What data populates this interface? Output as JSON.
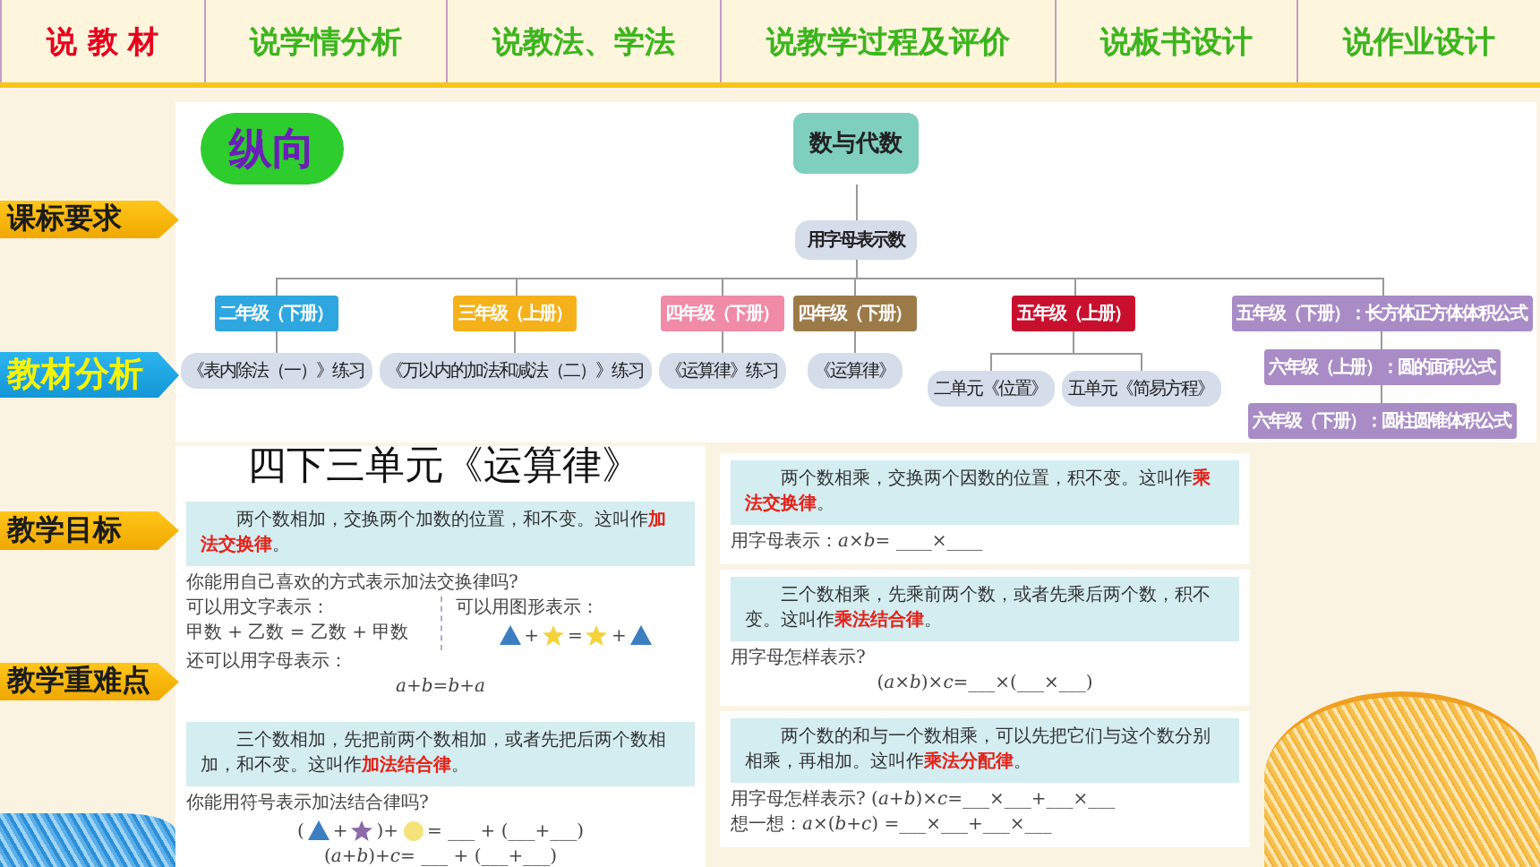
{
  "nav": [
    {
      "label": "说 教 材",
      "selected": true
    },
    {
      "label": "说学情分析",
      "selected": false
    },
    {
      "label": "说教法、学法",
      "selected": false
    },
    {
      "label": "说教学过程及评价",
      "selected": false
    },
    {
      "label": "说板书设计",
      "selected": false
    },
    {
      "label": "说作业设计",
      "selected": false
    }
  ],
  "sidebar": [
    {
      "label": "课标要求",
      "selected": false
    },
    {
      "label": "教材分析",
      "selected": true
    },
    {
      "label": "教学目标",
      "selected": false
    },
    {
      "label": "教学重难点",
      "selected": false
    }
  ],
  "diagram": {
    "tag": "纵向",
    "root": "数与代数",
    "branch": "用字母表示数",
    "grades": [
      {
        "label": "二年级（下册）",
        "color": "#2ea7e0",
        "kind": "pills",
        "children": [
          {
            "label": "《表内除法（一）》练习"
          }
        ]
      },
      {
        "label": "三年级（上册）",
        "color": "#f5b11a",
        "kind": "pills",
        "children": [
          {
            "label": "《万以内的加法和减法（二）》练习"
          }
        ]
      },
      {
        "label": "四年级（下册）",
        "color": "#f08aa6",
        "kind": "pills",
        "children": [
          {
            "label": "《运算律》练习"
          }
        ]
      },
      {
        "label": "四年级（下册）",
        "color": "#9c7a48",
        "kind": "pills",
        "children": [
          {
            "label": "《运算律》"
          }
        ]
      },
      {
        "label": "五年级（上册）",
        "color": "#c8102e",
        "kind": "pills",
        "children": [
          {
            "label": "二单元《位置》"
          },
          {
            "label": "五单元《简易方程》"
          }
        ]
      },
      {
        "label": "五年级（下册）：长方体正方体体积公式",
        "color": "#a98cc6",
        "kind": "chain",
        "children": [
          {
            "label": "六年级（上册）：圆的面积公式",
            "children": [
              {
                "label": "六年级（下册）：圆柱圆锥体积公式"
              }
            ]
          }
        ]
      }
    ]
  },
  "textbook": {
    "title": "四下三单元《运算律》",
    "left": [
      {
        "rule": "两个数相加，交换两个加数的位置，和不变。这叫作**加法交换律**。",
        "lines": [
          {
            "kind": "text",
            "text": "你能用自己喜欢的方式表示加法交换律吗?"
          },
          {
            "kind": "columns",
            "columns": [
              {
                "lines": [
                  {
                    "kind": "text",
                    "text": "可以用文字表示："
                  },
                  {
                    "kind": "text",
                    "text": "甲数 + 乙数 = 乙数 + 甲数"
                  }
                ]
              },
              {
                "lines": [
                  {
                    "kind": "text",
                    "text": "可以用图形表示："
                  },
                  {
                    "kind": "tokens",
                    "tokens": [
                      {
                        "kind": "triangle",
                        "color": "#3b7fc1"
                      },
                      {
                        "kind": "text",
                        "text": "+"
                      },
                      {
                        "kind": "star",
                        "color": "#f3d23a"
                      },
                      {
                        "kind": "text",
                        "text": "="
                      },
                      {
                        "kind": "star",
                        "color": "#f3d23a"
                      },
                      {
                        "kind": "text",
                        "text": "+"
                      },
                      {
                        "kind": "triangle",
                        "color": "#3b7fc1"
                      }
                    ]
                  }
                ]
              }
            ]
          },
          {
            "kind": "text",
            "text": "还可以用字母表示："
          },
          {
            "kind": "formula",
            "text": "*a*+*b*=*b*+*a*"
          }
        ]
      },
      {
        "rule": "三个数相加，先把前两个数相加，或者先把后两个数相加，和不变。这叫作**加法结合律**。",
        "lines": [
          {
            "kind": "text",
            "text": "你能用符号表示加法结合律吗?"
          },
          {
            "kind": "tokens",
            "tokens": [
              {
                "kind": "text",
                "text": "("
              },
              {
                "kind": "triangle",
                "color": "#3b7fc1"
              },
              {
                "kind": "text",
                "text": "+"
              },
              {
                "kind": "star",
                "color": "#8c6aa8"
              },
              {
                "kind": "text",
                "text": ")+"
              },
              {
                "kind": "circle",
                "color": "#f6e27a"
              },
              {
                "kind": "text",
                "text": "= ___ + (___+___)"
              }
            ]
          },
          {
            "kind": "formula",
            "text": "(*a*+*b*)+*c*= ___ + (___+___)"
          }
        ]
      }
    ],
    "right": [
      {
        "rule": "两个数相乘，交换两个因数的位置，积不变。这叫作**乘法交换律**。",
        "lines": [
          {
            "kind": "text",
            "text": "用字母表示：*a*×*b*= ____×____"
          }
        ]
      },
      {
        "rule": "三个数相乘，先乘前两个数，或者先乘后两个数，积不变。这叫作**乘法结合律**。",
        "lines": [
          {
            "kind": "text",
            "text": "用字母怎样表示?"
          },
          {
            "kind": "formula",
            "text": "(*a*×*b*)×*c*=___×(___×___)"
          }
        ]
      },
      {
        "rule": "两个数的和与一个数相乘，可以先把它们与这个数分别相乘，再相加。这叫作**乘法分配律**。",
        "lines": [
          {
            "kind": "text",
            "text": "用字母怎样表示?  (*a*+*b*)×*c*=___×___+___×___"
          },
          {
            "kind": "text",
            "text": "想一想：*a*×(*b*+*c*) =___×___+___×___"
          }
        ]
      }
    ]
  }
}
